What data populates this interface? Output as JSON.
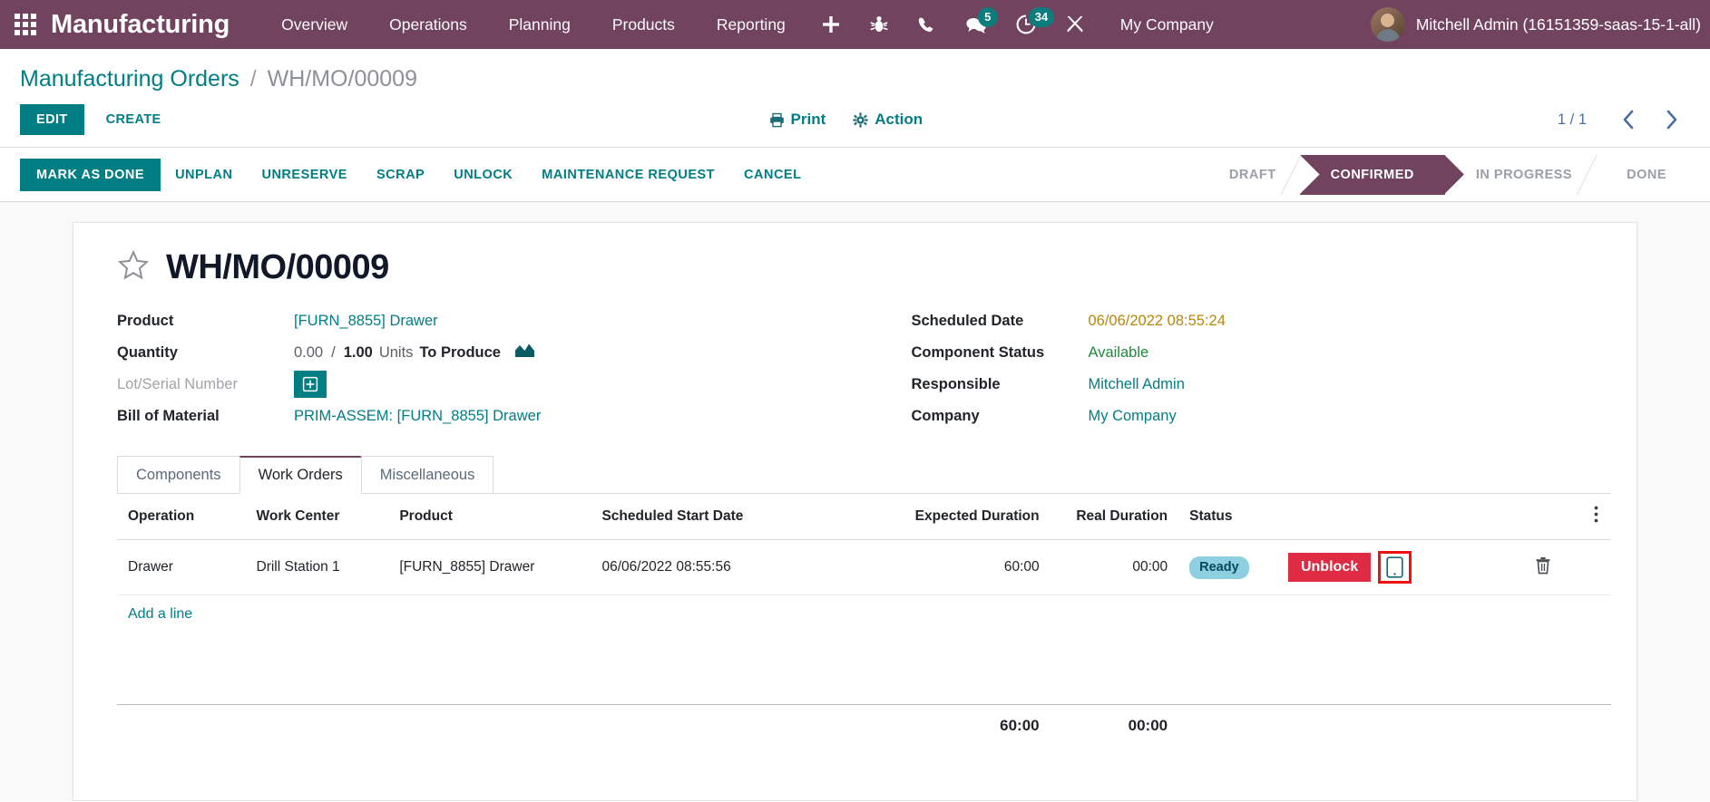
{
  "navbar": {
    "apps_icon": "apps-grid-icon",
    "brand": "Manufacturing",
    "menus": [
      {
        "label": "Overview",
        "name": "nav-overview"
      },
      {
        "label": "Operations",
        "name": "nav-operations"
      },
      {
        "label": "Planning",
        "name": "nav-planning"
      },
      {
        "label": "Products",
        "name": "nav-products"
      },
      {
        "label": "Reporting",
        "name": "nav-reporting"
      }
    ],
    "icons": [
      {
        "name": "plus-icon",
        "badge": ""
      },
      {
        "name": "bug-icon",
        "badge": ""
      },
      {
        "name": "phone-icon",
        "badge": ""
      },
      {
        "name": "chat-icon",
        "badge": "5"
      },
      {
        "name": "activity-clock-icon",
        "badge": "34"
      },
      {
        "name": "tools-icon",
        "badge": ""
      }
    ],
    "chat_badge": "5",
    "activity_badge": "34",
    "company": "My Company",
    "user": "Mitchell Admin (16151359-saas-15-1-all)"
  },
  "breadcrumb": {
    "parent": "Manufacturing Orders",
    "separator": "/",
    "current": "WH/MO/00009"
  },
  "control_panel": {
    "edit_label": "EDIT",
    "create_label": "CREATE",
    "print_label": "Print",
    "action_label": "Action",
    "pager": "1 / 1",
    "prev_icon": "chevron-left-icon",
    "next_icon": "chevron-right-icon"
  },
  "statusbar": {
    "buttons": [
      {
        "label": "MARK AS DONE",
        "name": "mark-as-done-button",
        "primary": true
      },
      {
        "label": "UNPLAN",
        "name": "unplan-button",
        "primary": false
      },
      {
        "label": "UNRESERVE",
        "name": "unreserve-button",
        "primary": false
      },
      {
        "label": "SCRAP",
        "name": "scrap-button",
        "primary": false
      },
      {
        "label": "UNLOCK",
        "name": "unlock-button",
        "primary": false
      },
      {
        "label": "MAINTENANCE REQUEST",
        "name": "maintenance-request-button",
        "primary": false
      },
      {
        "label": "CANCEL",
        "name": "cancel-button",
        "primary": false
      }
    ],
    "stages": [
      {
        "label": "DRAFT",
        "active": false
      },
      {
        "label": "CONFIRMED",
        "active": true
      },
      {
        "label": "IN PROGRESS",
        "active": false
      },
      {
        "label": "DONE",
        "active": false
      }
    ]
  },
  "record": {
    "star_icon": "star-outline-icon",
    "title": "WH/MO/00009",
    "left_fields": {
      "product_label": "Product",
      "product_value": "[FURN_8855] Drawer",
      "quantity_label": "Quantity",
      "quantity_done": "0.00",
      "quantity_sep": "/",
      "quantity_target": "1.00",
      "quantity_unit": "Units",
      "quantity_suffix": "To Produce",
      "quantity_chart_icon": "area-chart-icon",
      "lot_label": "Lot/Serial Number",
      "lot_button_icon": "plus-square-icon",
      "bom_label": "Bill of Material",
      "bom_value": "PRIM-ASSEM: [FURN_8855] Drawer"
    },
    "right_fields": {
      "scheduled_label": "Scheduled Date",
      "scheduled_value": "06/06/2022 08:55:24",
      "component_status_label": "Component Status",
      "component_status_value": "Available",
      "responsible_label": "Responsible",
      "responsible_value": "Mitchell Admin",
      "company_label": "Company",
      "company_value": "My Company"
    }
  },
  "notebook": {
    "tabs": [
      {
        "label": "Components",
        "active": false
      },
      {
        "label": "Work Orders",
        "active": true
      },
      {
        "label": "Miscellaneous",
        "active": false
      }
    ]
  },
  "work_orders": {
    "columns": [
      "Operation",
      "Work Center",
      "Product",
      "Scheduled Start Date",
      "Expected Duration",
      "Real Duration",
      "Status"
    ],
    "options_icon": "vertical-dots-icon",
    "rows": [
      {
        "operation": "Drawer",
        "work_center": "Drill Station 1",
        "product": "[FURN_8855] Drawer",
        "scheduled_start_date": "06/06/2022 08:55:56",
        "expected_duration": "60:00",
        "real_duration": "00:00",
        "status": "Ready",
        "unblock_label": "Unblock",
        "tablet_icon": "tablet-icon",
        "delete_icon": "trash-icon"
      }
    ],
    "add_line_label": "Add a line",
    "totals": {
      "expected_duration": "60:00",
      "real_duration": "00:00"
    }
  },
  "colors": {
    "navbar_purple": "#71435f",
    "accent_teal": "#017e84",
    "danger_red": "#e02b44",
    "highlight_red": "#ee1111",
    "badge_blue": "#8ed0e0",
    "date_amber": "#b8860b",
    "available_green": "#1f8a3b"
  }
}
